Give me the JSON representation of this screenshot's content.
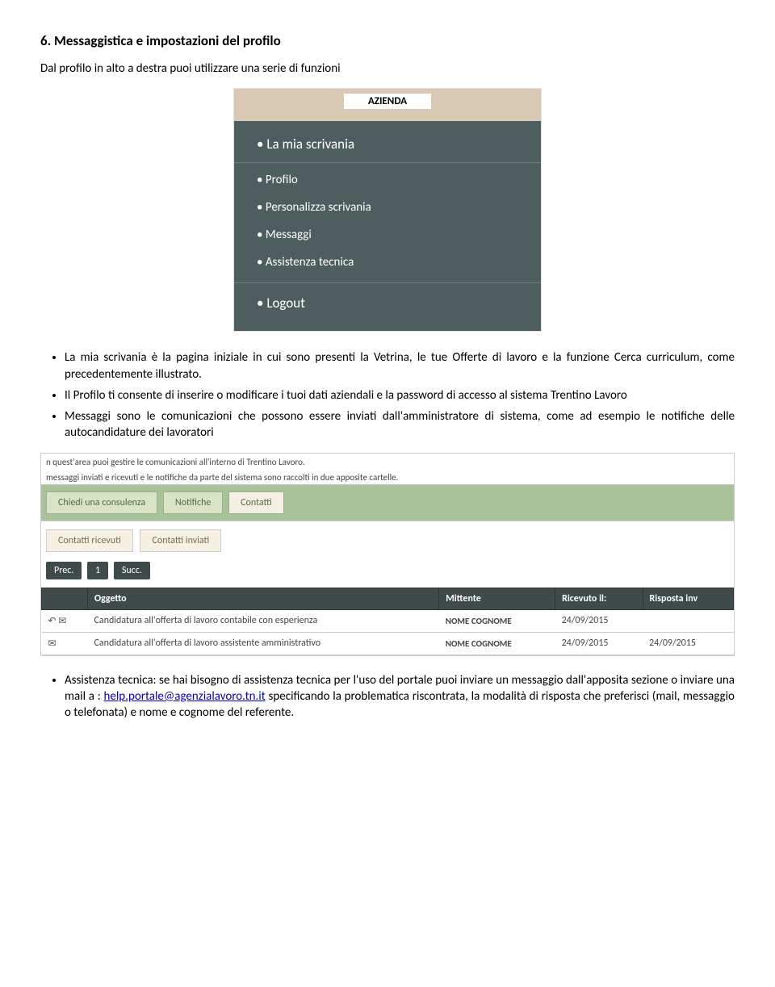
{
  "heading": "6. Messaggistica e impostazioni del profilo",
  "intro": "Dal profilo in alto a destra puoi utilizzare una serie di funzioni",
  "dropdown": {
    "header": "AZIENDA",
    "items": [
      "La mia scrivania",
      "Profilo",
      "Personalizza scrivania",
      "Messaggi",
      "Assistenza tecnica",
      "Logout"
    ]
  },
  "bullets1": [
    "La mia scrivania è la pagina iniziale in cui sono presenti  la Vetrina, le tue Offerte di lavoro e la funzione Cerca curriculum, come precedentemente illustrato.",
    "Il Profilo  ti consente di inserire o modificare i tuoi dati aziendali e la password di accesso al sistema Trentino Lavoro",
    "Messaggi sono le comunicazioni che  possono essere inviati dall'amministratore di sistema, come ad esempio le notifiche delle autocandidature dei lavoratori"
  ],
  "msg": {
    "desc1": "n quest'area puoi gestire le comunicazioni all'interno di Trentino Lavoro.",
    "desc2": "messaggi inviati e ricevuti e le notifiche da parte del sistema sono raccolti in due apposite cartelle.",
    "tabs": [
      "Chiedi una consulenza",
      "Notifiche",
      "Contatti"
    ],
    "subtabs": [
      "Contatti ricevuti",
      "Contatti inviati"
    ],
    "pager": [
      "Prec.",
      "1",
      "Succ."
    ],
    "cols": [
      "Oggetto",
      "Mittente",
      "Ricevuto il:",
      "Risposta inv"
    ],
    "rows": [
      {
        "ic1": "↶",
        "ic2": "✉",
        "oggetto": "Candidatura all'offerta di lavoro contabile con esperienza",
        "mitt": "NOME COGNOME",
        "ric": "24/09/2015",
        "risp": ""
      },
      {
        "ic1": "",
        "ic2": "✉",
        "oggetto": "Candidatura all'offerta di lavoro assistente amministrativo",
        "mitt": "NOME COGNOME",
        "ric": "24/09/2015",
        "risp": "24/09/2015"
      }
    ]
  },
  "bullets2": {
    "pre": "Assistenza tecnica: se hai bisogno di assistenza tecnica per l'uso del portale puoi inviare un messaggio dall'apposita sezione o inviare una mail a : ",
    "mail": "help.portale@agenzialavoro.tn.it",
    "post": " specificando la problematica riscontrata, la modalità di risposta che preferisci (mail, messaggio o telefonata) e nome e cognome del referente."
  }
}
